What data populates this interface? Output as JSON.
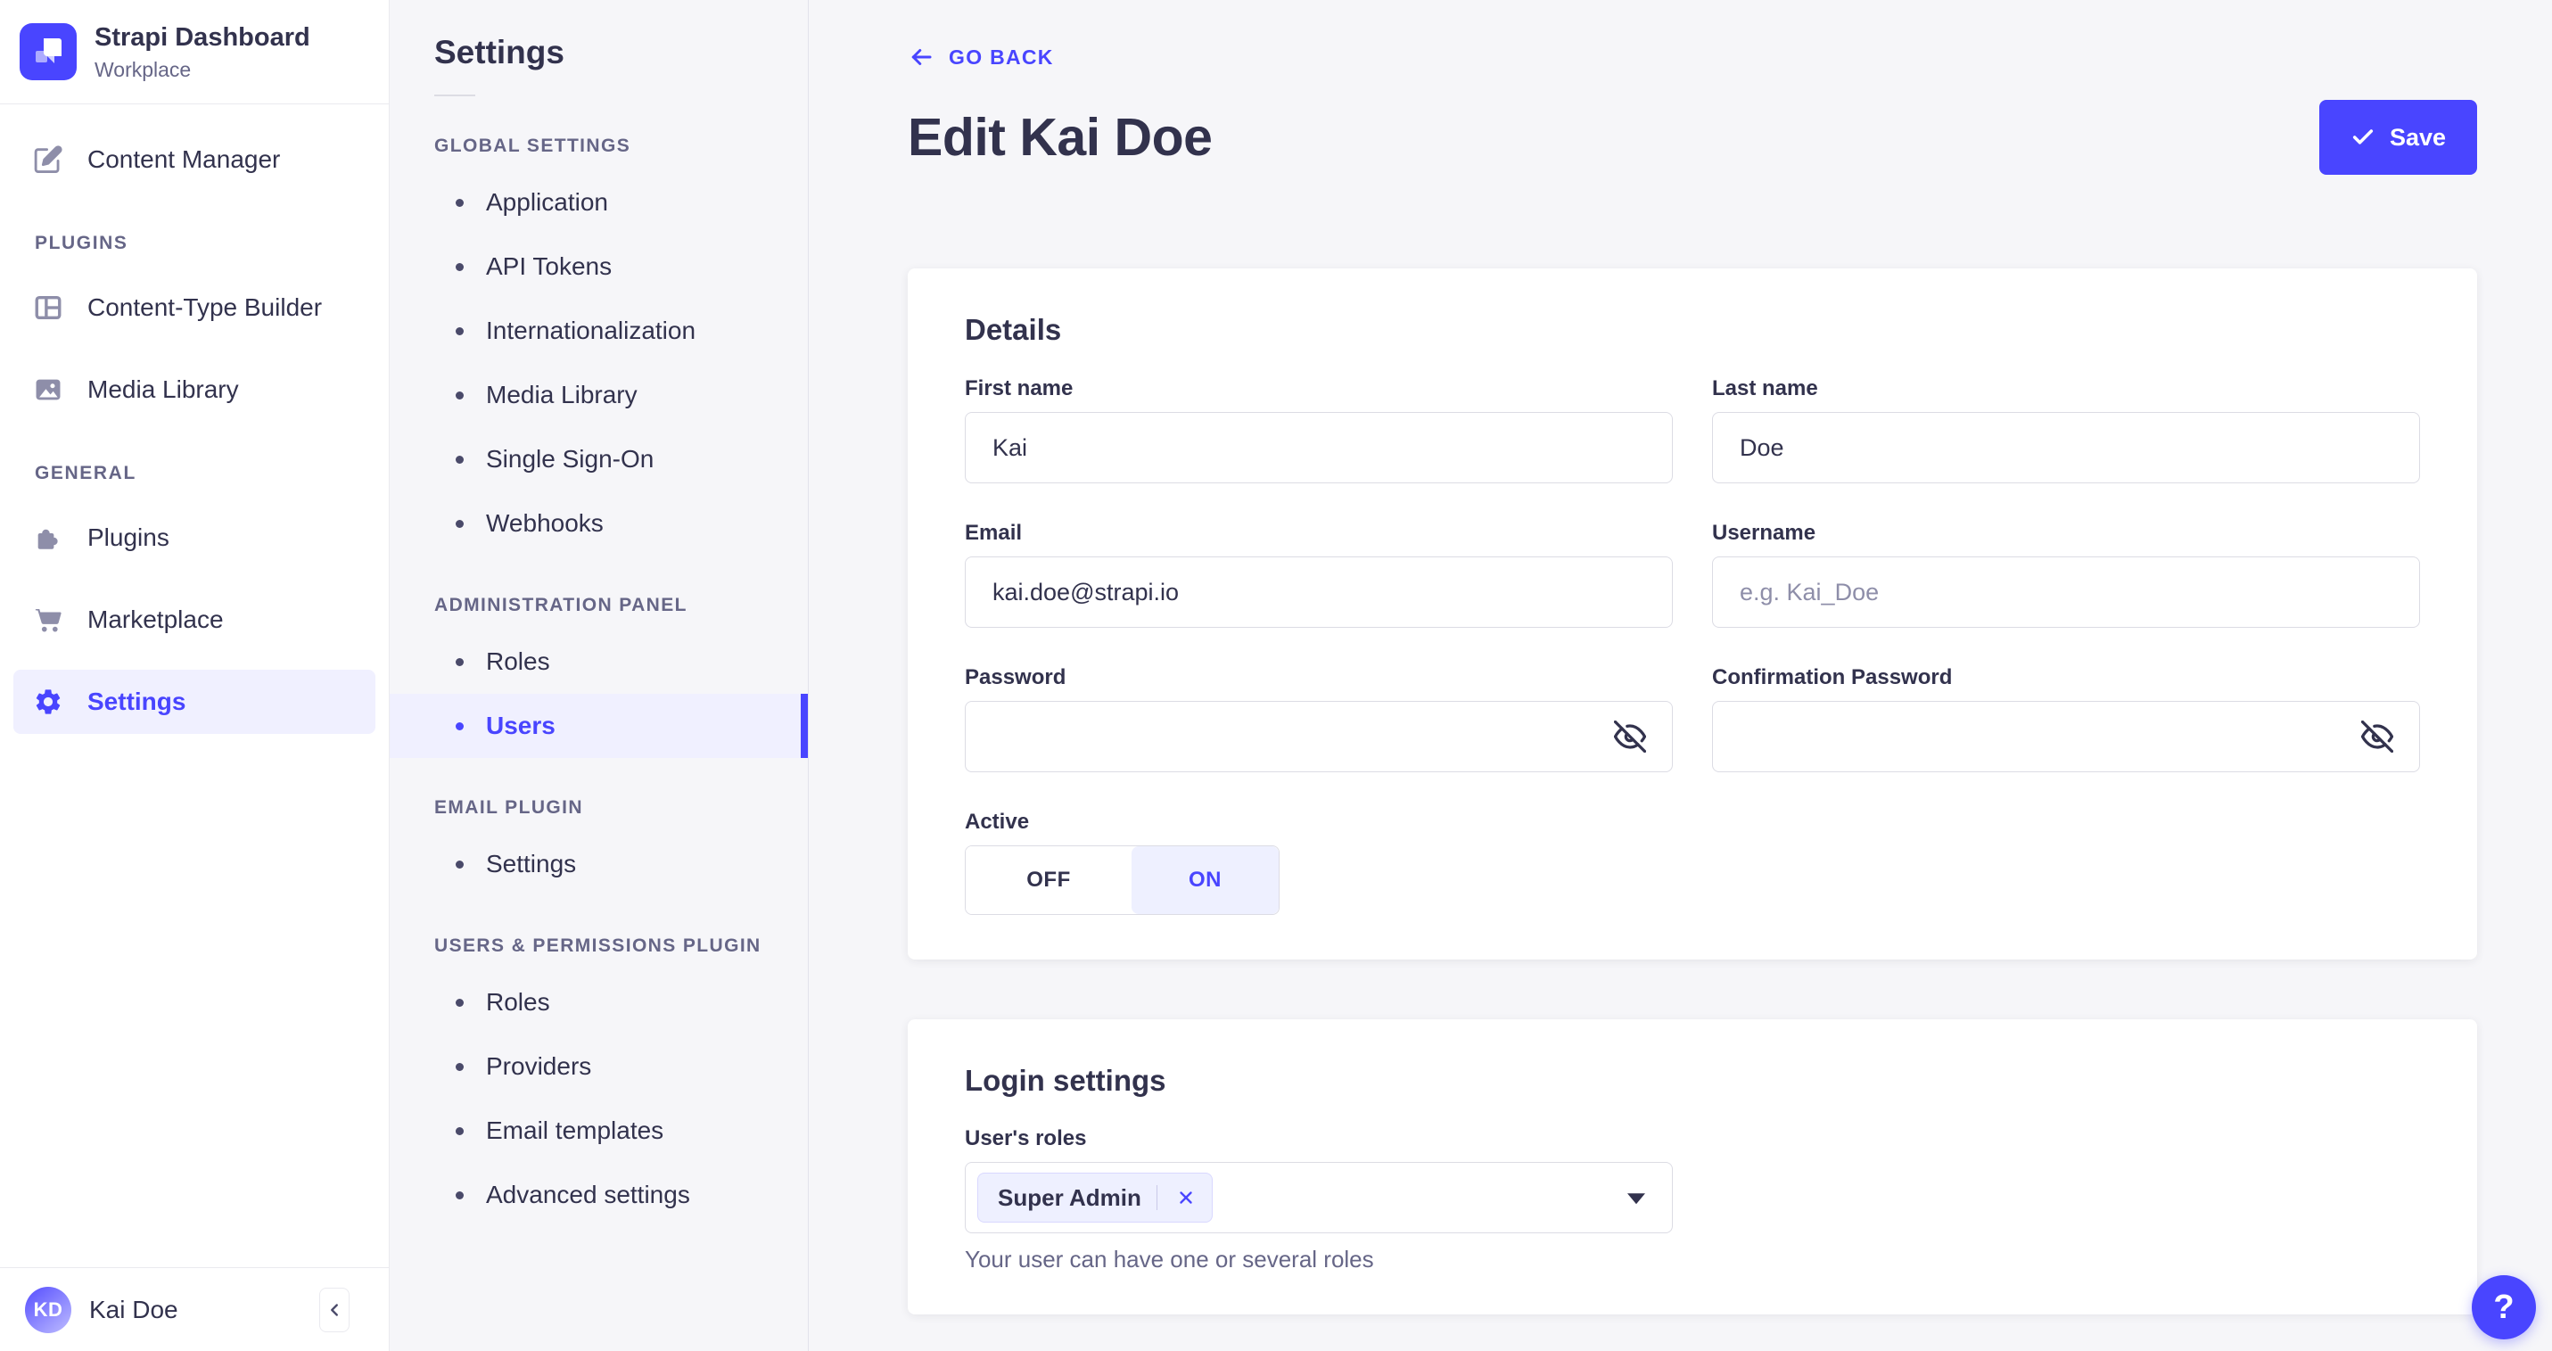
{
  "app": {
    "title": "Strapi Dashboard",
    "subtitle": "Workplace"
  },
  "sidebar": {
    "content_manager": "Content Manager",
    "sections": [
      {
        "title": "PLUGINS",
        "items": [
          {
            "label": "Content-Type Builder"
          },
          {
            "label": "Media Library"
          }
        ]
      },
      {
        "title": "GENERAL",
        "items": [
          {
            "label": "Plugins"
          },
          {
            "label": "Marketplace"
          },
          {
            "label": "Settings"
          }
        ]
      }
    ],
    "user": {
      "initials": "KD",
      "name": "Kai Doe"
    }
  },
  "subnav": {
    "title": "Settings",
    "sections": [
      {
        "title": "GLOBAL SETTINGS",
        "items": [
          "Application",
          "API Tokens",
          "Internationalization",
          "Media Library",
          "Single Sign-On",
          "Webhooks"
        ]
      },
      {
        "title": "ADMINISTRATION PANEL",
        "items": [
          "Roles",
          "Users"
        ],
        "active_item": "Users"
      },
      {
        "title": "EMAIL PLUGIN",
        "items": [
          "Settings"
        ]
      },
      {
        "title": "USERS & PERMISSIONS PLUGIN",
        "items": [
          "Roles",
          "Providers",
          "Email templates",
          "Advanced settings"
        ]
      }
    ]
  },
  "header": {
    "back": "GO BACK",
    "title": "Edit Kai Doe",
    "save": "Save"
  },
  "details": {
    "title": "Details",
    "first_name": {
      "label": "First name",
      "value": "Kai"
    },
    "last_name": {
      "label": "Last name",
      "value": "Doe"
    },
    "email": {
      "label": "Email",
      "value": "kai.doe@strapi.io"
    },
    "username": {
      "label": "Username",
      "value": "",
      "placeholder": "e.g. Kai_Doe"
    },
    "password": {
      "label": "Password",
      "value": ""
    },
    "confirm_password": {
      "label": "Confirmation Password",
      "value": ""
    },
    "active": {
      "label": "Active",
      "off": "OFF",
      "on": "ON",
      "value": "ON"
    }
  },
  "login": {
    "title": "Login settings",
    "roles_label": "User's roles",
    "tag": "Super Admin",
    "helper": "Your user can have one or several roles"
  },
  "help": {
    "label": "?"
  },
  "colors": {
    "primary": "#4945ff",
    "primary_light": "#f0f0ff",
    "text": "#32324d",
    "muted": "#666687",
    "border": "#dcdce4",
    "bg": "#f6f6f9"
  }
}
